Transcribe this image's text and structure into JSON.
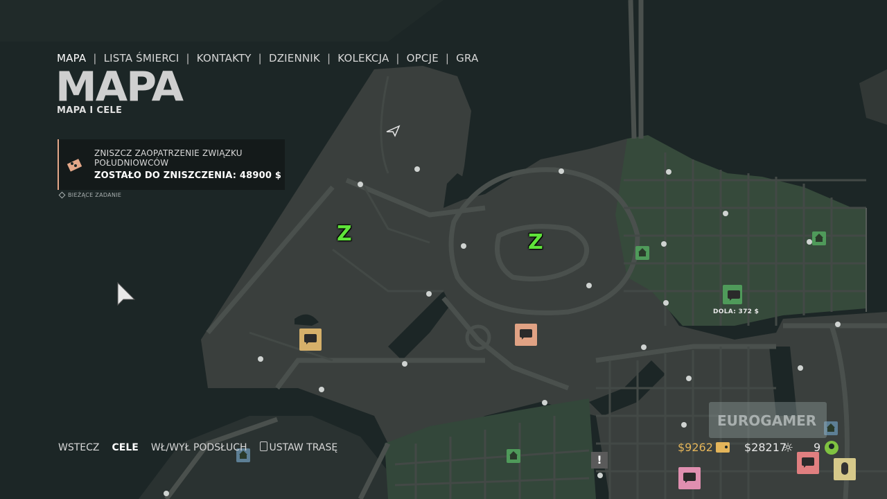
{
  "nav": {
    "items": [
      {
        "label": "MAPA",
        "active": true
      },
      {
        "label": "LISTA ŚMIERCI"
      },
      {
        "label": "KONTAKTY"
      },
      {
        "label": "DZIENNIK"
      },
      {
        "label": "KOLEKCJA"
      },
      {
        "label": "OPCJE"
      },
      {
        "label": "GRA"
      }
    ],
    "separator": "|"
  },
  "page": {
    "title": "MAPA",
    "subtitle": "MAPA I CELE"
  },
  "objective": {
    "line1": "ZNISZCZ ZAOPATRZENIE ZWIĄZKU POŁUDNIOWCÓW",
    "line2": "ZOSTAŁO DO ZNISZCZENIA: 48900 $",
    "current_task": "BIEŻĄCE ZADANIE",
    "accent": "#e5a889"
  },
  "controls": {
    "back": "WSTECZ",
    "objectives": "CELE",
    "wiretap": "WŁ/WYŁ PODSŁUCH",
    "set_route": "USTAW TRASĘ"
  },
  "hud": {
    "cash": "$9262",
    "bank": "$28217",
    "cogs_symbol": "☼",
    "points": "9",
    "watermark": "EUROGAMER"
  },
  "map": {
    "markers": {
      "z_label": "Z",
      "dola_label": "DOLA: 372 $",
      "alert_symbol": "!"
    },
    "colors": {
      "water": "#1c2626",
      "land": "#3a3f3d",
      "road": "#4a4f4c",
      "green_district": "#3a4e3d",
      "yellow_bubble": "#d6b06a",
      "salmon_bubble": "#e0a284",
      "pink_bubble": "#e08fb0",
      "red_bubble": "#e07f80",
      "green_house": "#4f9a5a",
      "blue_house": "#5d7f95"
    }
  }
}
